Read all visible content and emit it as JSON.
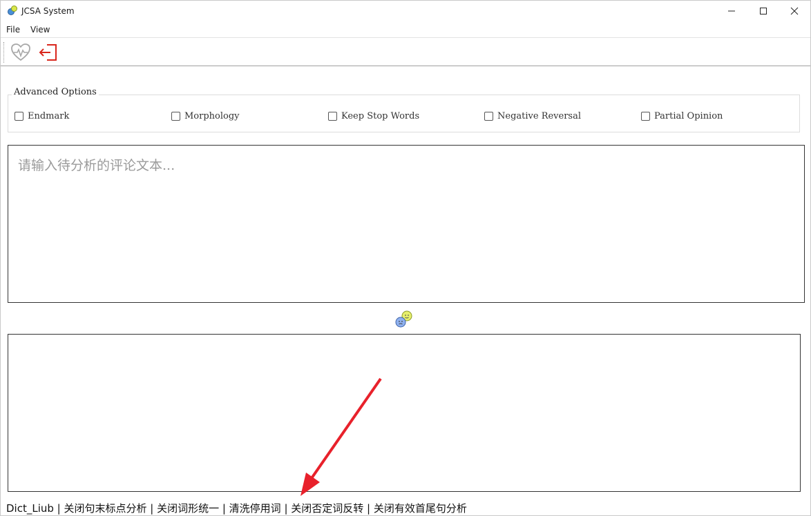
{
  "window": {
    "title": "JCSA System",
    "controls": {
      "minimize": "minimize-icon",
      "maximize": "maximize-icon",
      "close": "close-icon"
    }
  },
  "menu": {
    "file": "File",
    "view": "View"
  },
  "toolbar": {
    "health_icon": "heart-pulse-icon",
    "exit_icon": "exit-icon",
    "accent_color": "#d9261c"
  },
  "options": {
    "legend": "Advanced Options",
    "items": [
      {
        "label": "Endmark",
        "checked": false
      },
      {
        "label": "Morphology",
        "checked": false
      },
      {
        "label": "Keep Stop Words",
        "checked": false
      },
      {
        "label": "Negative Reversal",
        "checked": false
      },
      {
        "label": "Partial Opinion",
        "checked": false
      }
    ]
  },
  "input": {
    "placeholder": "请输入待分析的评论文本...",
    "value": ""
  },
  "output": {
    "value": ""
  },
  "analyze": {
    "icon": "sentiment-faces-icon"
  },
  "status": {
    "text": "Dict_Liub | 关闭句末标点分析 | 关闭词形统一 | 清洗停用词 | 关闭否定词反转 | 关闭有效首尾句分析"
  }
}
